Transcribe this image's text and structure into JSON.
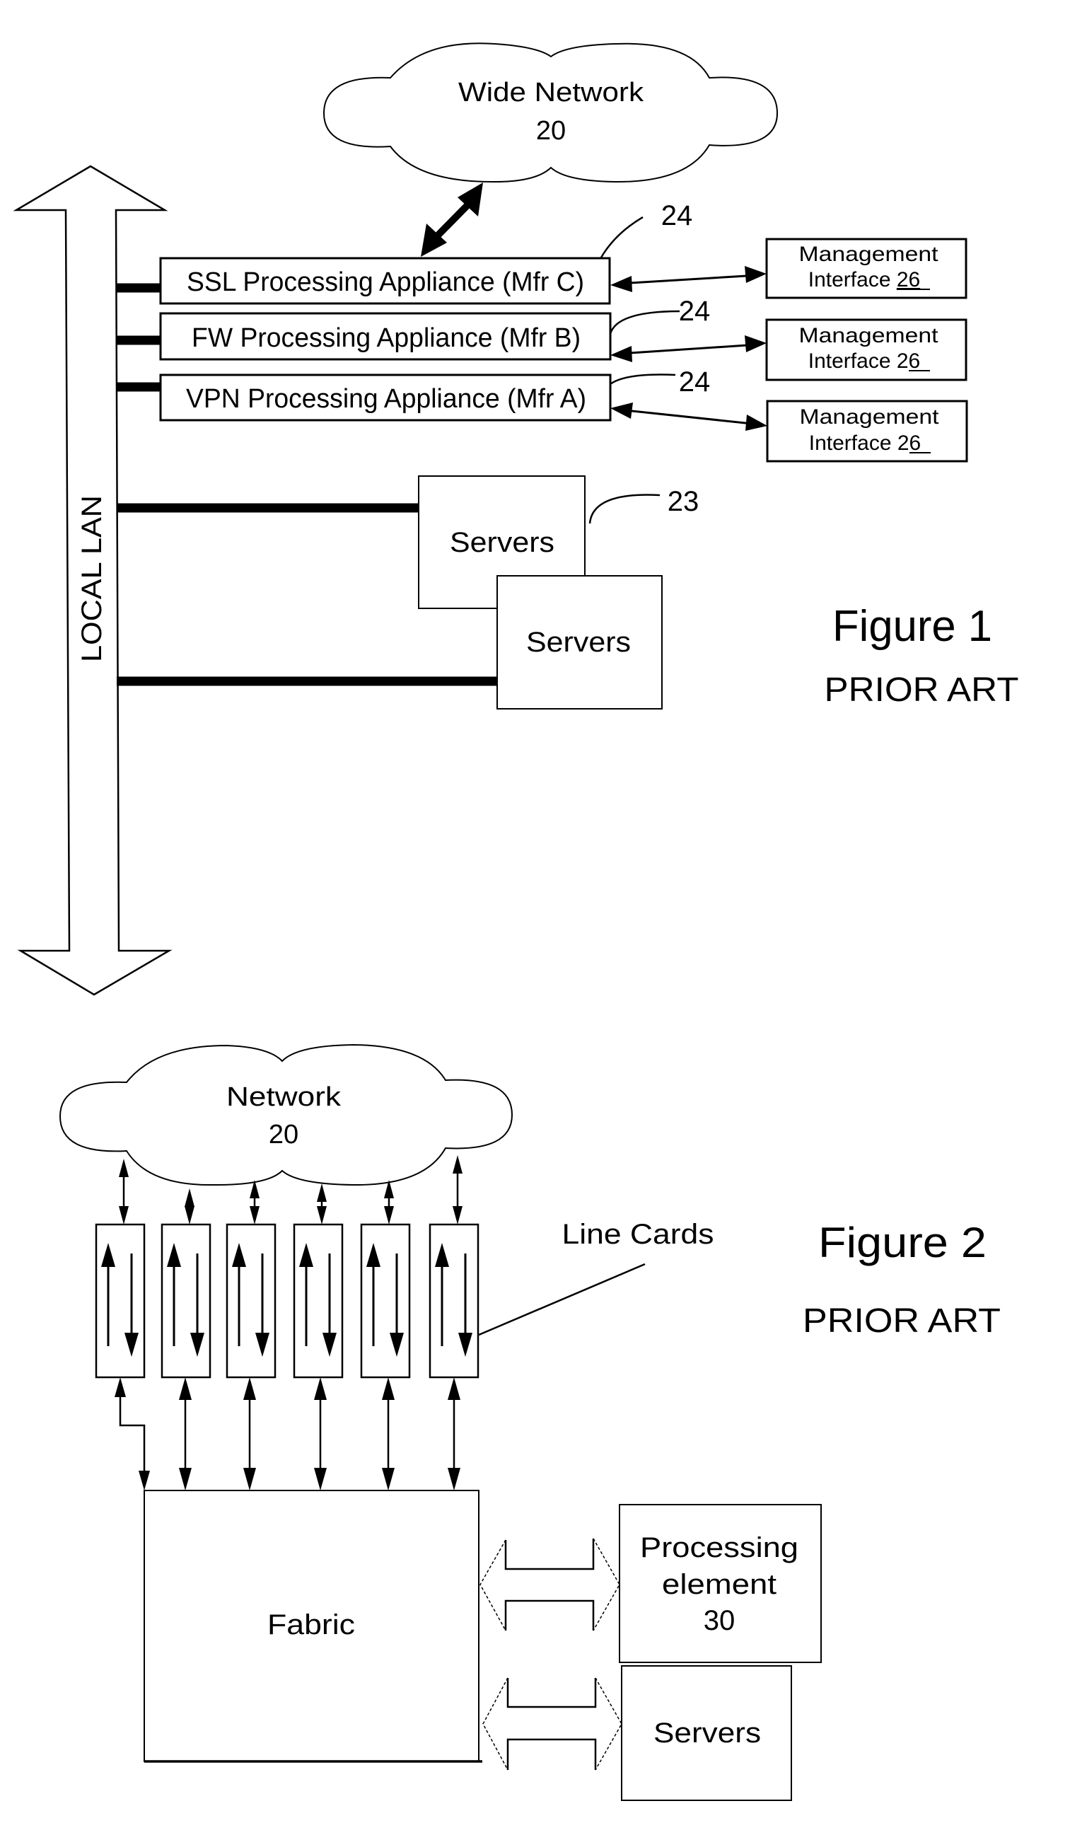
{
  "figure1": {
    "title": "Figure 1",
    "subtitle": "PRIOR ART",
    "wide_network": {
      "label": "Wide Network",
      "ref": "20"
    },
    "local_lan": "LOCAL LAN",
    "appliances": [
      {
        "label": "SSL Processing Appliance (Mfr C)",
        "ref": "24"
      },
      {
        "label": "FW Processing Appliance (Mfr B)",
        "ref": "24"
      },
      {
        "label": "VPN Processing Appliance (Mfr A)",
        "ref": "24"
      }
    ],
    "management": [
      {
        "line1": "Management",
        "line2": "Interface",
        "ref": "26"
      },
      {
        "line1": "Management",
        "line2": "Interface",
        "ref": "26"
      },
      {
        "line1": "Management",
        "line2": "Interface",
        "ref": "26"
      }
    ],
    "servers": {
      "labels": [
        "Servers",
        "Servers"
      ],
      "ref": "23"
    }
  },
  "figure2": {
    "title": "Figure 2",
    "subtitle": "PRIOR ART",
    "network": {
      "label": "Network",
      "ref": "20"
    },
    "line_cards_label": "Line Cards",
    "line_card_count": 6,
    "fabric": "Fabric",
    "processing_element": {
      "line1": "Processing",
      "line2": "element",
      "ref": "30"
    },
    "servers": "Servers"
  }
}
